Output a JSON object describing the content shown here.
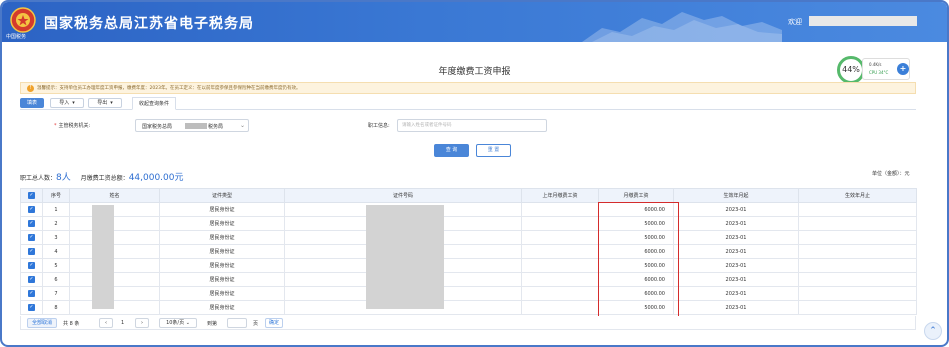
{
  "header": {
    "app_title": "国家税务总局江苏省电子税务局",
    "emblem_text": "中国税务",
    "welcome": "欢迎"
  },
  "page": {
    "title": "年度缴费工资申报"
  },
  "perf": {
    "percent": "44%",
    "speed": "0.4K/s",
    "cpu": "CPU 34°C"
  },
  "hint": {
    "text": "温馨提示：支持单位员工办理年度工资申报，缴费年度：2023年。在员工定义：在以前年度参保且参保险种在当前缴费年度仍有效。"
  },
  "tabs": {
    "write_label": "填表",
    "import_label": "导入",
    "export_label": "导出",
    "query_tab_label": "收起查询条件"
  },
  "form": {
    "tax_authority_label": "主管税务机关:",
    "tax_authority_value_prefix": "国家税务总局",
    "tax_authority_value_suffix": "税务局",
    "employee_info_label": "职工信息:",
    "employee_info_placeholder": "请输入姓名或者证件号码",
    "query_button": "查 询",
    "reset_button": "重 置"
  },
  "summary": {
    "total_employees_label": "职工总人数：",
    "total_employees_value": "8人",
    "monthly_wage_total_label": "月缴费工资总额：",
    "monthly_wage_total_value": "44,000.00元"
  },
  "unit_label": "单位（金额）：元",
  "table": {
    "headers": [
      "序号",
      "姓名",
      "证件类型",
      "证件号码",
      "上年月缴费工资",
      "月缴费工资",
      "生效年月起",
      "生效年月止"
    ],
    "rows": [
      {
        "no": "1",
        "id_type": "居民身份证",
        "prev_wage": "",
        "wage": "6000.00",
        "start": "2023-01",
        "end": ""
      },
      {
        "no": "2",
        "id_type": "居民身份证",
        "prev_wage": "",
        "wage": "5000.00",
        "start": "2023-01",
        "end": ""
      },
      {
        "no": "3",
        "id_type": "居民身份证",
        "prev_wage": "",
        "wage": "5000.00",
        "start": "2023-01",
        "end": ""
      },
      {
        "no": "4",
        "id_type": "居民身份证",
        "prev_wage": "",
        "wage": "6000.00",
        "start": "2023-01",
        "end": ""
      },
      {
        "no": "5",
        "id_type": "居民身份证",
        "prev_wage": "",
        "wage": "5000.00",
        "start": "2023-01",
        "end": ""
      },
      {
        "no": "6",
        "id_type": "居民身份证",
        "prev_wage": "",
        "wage": "6000.00",
        "start": "2023-01",
        "end": ""
      },
      {
        "no": "7",
        "id_type": "居民身份证",
        "prev_wage": "",
        "wage": "6000.00",
        "start": "2023-01",
        "end": ""
      },
      {
        "no": "8",
        "id_type": "居民身份证",
        "prev_wage": "",
        "wage": "5000.00",
        "start": "2023-01",
        "end": ""
      }
    ]
  },
  "pager": {
    "select_all": "全部取消",
    "total": "共 8 条",
    "prev": "‹",
    "page": "1",
    "next": "›",
    "page_size": "10条/页",
    "goto_label": "到第",
    "goto_value": "",
    "page_unit": "页",
    "confirm": "确定"
  },
  "icons": {
    "emblem": "tax-emblem-icon",
    "hint": "warning-icon",
    "checkbox": "checkbox-checked-icon",
    "scroll": "scroll-to-top-icon"
  },
  "colors": {
    "header_blue": "#3a78d4",
    "accent_blue": "#2f77d9",
    "highlight_red": "#d42c2c",
    "perf_green": "#56b96b"
  }
}
